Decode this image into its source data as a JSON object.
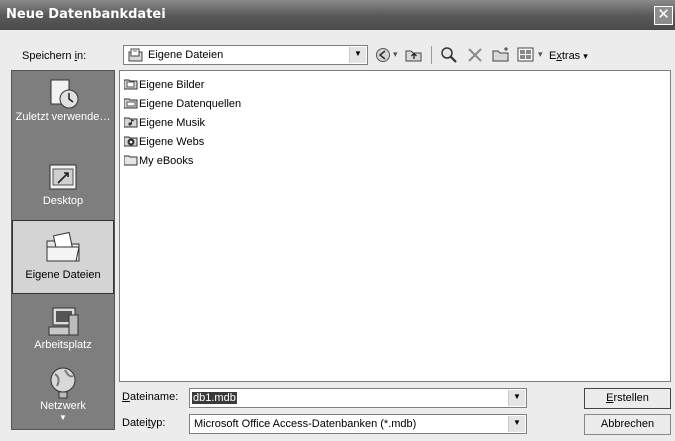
{
  "window": {
    "title": "Neue Datenbankdatei",
    "close_glyph": "✕"
  },
  "save_in": {
    "label_pre": "Speichern ",
    "label_key": "i",
    "label_post": "n:",
    "value": "Eigene Dateien"
  },
  "toolbar": {
    "extras_pre": "E",
    "extras_key": "x",
    "extras_post": "tras",
    "dropdown_glyph": "▾"
  },
  "places": [
    {
      "label": "Zuletzt verwende…",
      "icon": "recent-documents-icon"
    },
    {
      "label": "Desktop",
      "icon": "desktop-icon"
    },
    {
      "label": "Eigene Dateien",
      "icon": "my-documents-icon",
      "selected": true
    },
    {
      "label": "Arbeitsplatz",
      "icon": "my-computer-icon"
    },
    {
      "label": "Netzwerk",
      "icon": "network-icon"
    }
  ],
  "files": [
    {
      "name": "Eigene Bilder",
      "icon": "pictures-folder-icon"
    },
    {
      "name": "Eigene Datenquellen",
      "icon": "data-sources-folder-icon"
    },
    {
      "name": "Eigene Musik",
      "icon": "music-folder-icon"
    },
    {
      "name": "Eigene Webs",
      "icon": "webs-folder-icon"
    },
    {
      "name": "My eBooks",
      "icon": "folder-icon"
    }
  ],
  "filename": {
    "label_key": "D",
    "label_post": "ateiname:",
    "value": "db1.mdb"
  },
  "filetype": {
    "label_pre": "Datei",
    "label_key": "t",
    "label_post": "yp:",
    "value": "Microsoft Office Access-Datenbanken (*.mdb)"
  },
  "buttons": {
    "create_key": "E",
    "create_post": "rstellen",
    "cancel": "Abbrechen"
  },
  "down_glyph": "▼",
  "more_glyph": "▼"
}
